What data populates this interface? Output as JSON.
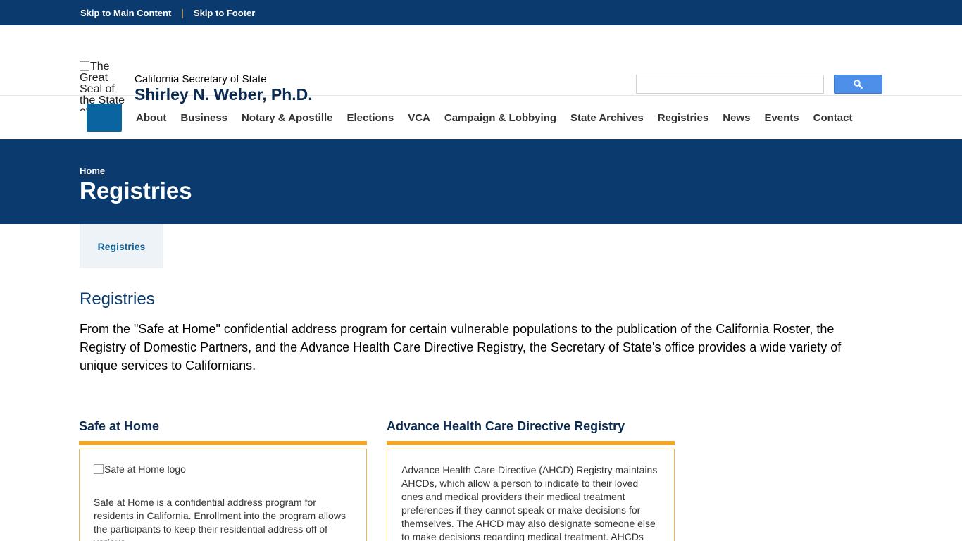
{
  "skip_bar": {
    "main_content": "Skip to Main Content",
    "separator": "|",
    "footer": "Skip to Footer"
  },
  "header": {
    "seal_alt": "The Great Seal of the State of California",
    "office": "California Secretary of State",
    "name": "Shirley N. Weber, Ph.D.",
    "search_placeholder": ""
  },
  "nav": {
    "items": [
      "About",
      "Business",
      "Notary & Apostille",
      "Elections",
      "VCA",
      "Campaign & Lobbying",
      "State Archives",
      "Registries",
      "News",
      "Events",
      "Contact"
    ]
  },
  "hero": {
    "breadcrumb": "Home",
    "title": "Registries"
  },
  "subnav": {
    "tab": "Registries"
  },
  "main": {
    "heading": "Registries",
    "intro": "From the \"Safe at Home\" confidential address program for certain vulnerable populations to the publication of the California Roster, the Registry of Domestic Partners, and the Advance Health Care Directive Registry, the Secretary of State's office provides a wide variety of unique services to Californians."
  },
  "cards": [
    {
      "title": "Safe at Home",
      "logo_alt": "Safe at Home logo",
      "text": "Safe at Home is a confidential address program for residents in California. Enrollment into the program allows the participants to keep their residential address off of various"
    },
    {
      "title": "Advance Health Care Directive Registry",
      "text": "Advance Health Care Directive (AHCD) Registry maintains AHCDs, which allow a person to indicate to their loved ones and medical providers their medical treatment preferences if they cannot speak or make decisions for themselves. The AHCD may also designate someone else to make decisions regarding medical treatment. AHCDs and related information"
    }
  ],
  "colors": {
    "navy": "#0b3a6e",
    "accent_orange": "#f5a623",
    "search_blue": "#4d8fe9",
    "home_button_blue": "#0a64a0"
  },
  "icons": {
    "search": "search-icon",
    "home": "home-icon"
  }
}
